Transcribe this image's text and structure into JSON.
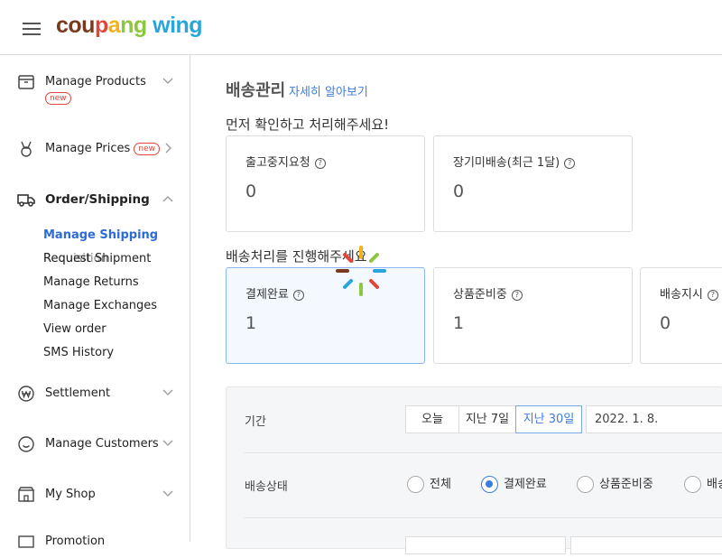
{
  "header": {
    "logo": {
      "part1": "cou",
      "part2": "p",
      "part3": "a",
      "part4": "ng",
      "part5": " wing"
    }
  },
  "sidebar": {
    "items": [
      {
        "label": "Manage Products",
        "badge": "new",
        "icon": "box-icon",
        "chevron": "down"
      },
      {
        "label": "Manage Prices",
        "badge": "new",
        "icon": "medal-icon",
        "chevron": "right"
      },
      {
        "label": "Order/Shipping",
        "icon": "truck-icon",
        "chevron": "up"
      },
      {
        "label": "Settlement",
        "icon": "won-icon",
        "chevron": "down"
      },
      {
        "label": "Manage Customers",
        "icon": "smile-icon",
        "chevron": "down"
      },
      {
        "label": "My Shop",
        "icon": "shop-icon",
        "chevron": "down"
      },
      {
        "label": "Promotion",
        "icon": "promo-icon",
        "chevron": "down"
      }
    ],
    "subitems": [
      {
        "label": "Manage Shipping"
      },
      {
        "label": "Request Shipment"
      },
      {
        "label": "Manage Returns"
      },
      {
        "label": "Manage Exchanges"
      },
      {
        "label": "View order"
      },
      {
        "label": "SMS History"
      }
    ],
    "overlap_text": "Requisition"
  },
  "main": {
    "title": "배송관리",
    "learn_more": "자세히 알아보기",
    "section1": "먼저 확인하고 처리해주세요!",
    "section2": "배송처리를 진행해주세요",
    "cards_top": [
      {
        "title": "출고중지요청",
        "value": "0"
      },
      {
        "title": "장기미배송(최근 1달)",
        "value": "0"
      }
    ],
    "cards_bottom": [
      {
        "title": "결제완료",
        "value": "1"
      },
      {
        "title": "상품준비중",
        "value": "1"
      },
      {
        "title": "배송지시",
        "value": "0"
      }
    ],
    "filters": {
      "period_label": "기간",
      "period_options": [
        "오늘",
        "지난 7일",
        "지난 30일"
      ],
      "date_value": "2022. 1. 8.",
      "status_label": "배송상태",
      "status_options": [
        "전체",
        "결제완료",
        "상품준비중",
        "배송"
      ],
      "selected_status": "결제완료"
    }
  },
  "colors": {
    "accent": "#3b7ddd",
    "badge": "#e0463a",
    "selected_card_bg": "#f4f8ff"
  }
}
